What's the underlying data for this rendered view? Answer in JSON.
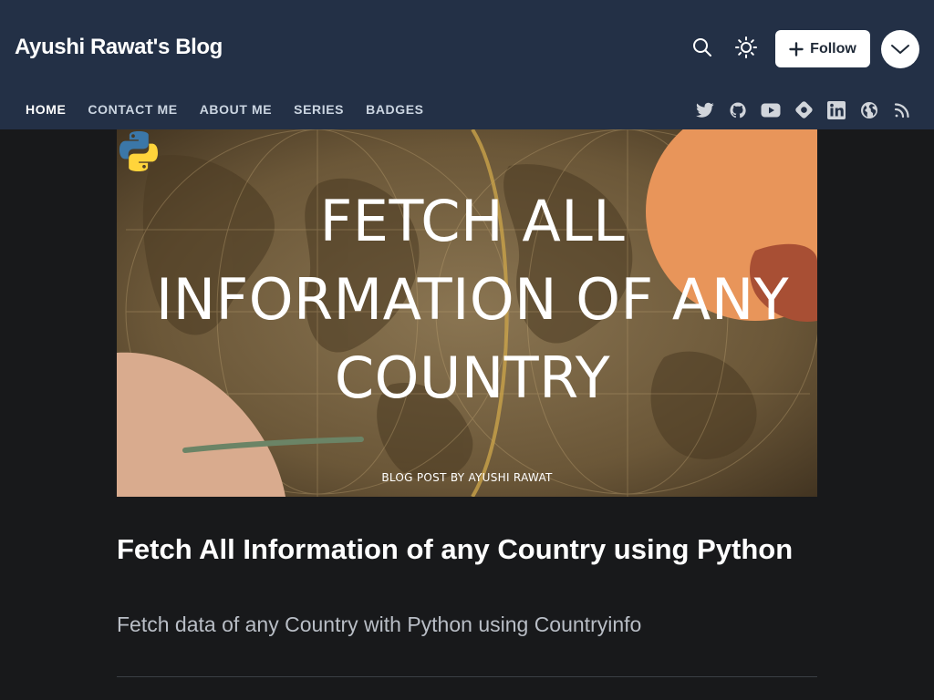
{
  "header": {
    "blog_title": "Ayushi Rawat's Blog",
    "follow_label": "Follow"
  },
  "nav": {
    "items": [
      {
        "label": "HOME",
        "active": true
      },
      {
        "label": "CONTACT ME"
      },
      {
        "label": "ABOUT ME"
      },
      {
        "label": "SERIES"
      },
      {
        "label": "BADGES"
      }
    ]
  },
  "social_icons": [
    "twitter-icon",
    "github-icon",
    "youtube-icon",
    "hashnode-icon",
    "linkedin-icon",
    "website-icon",
    "rss-icon"
  ],
  "cover": {
    "title": "FETCH ALL INFORMATION OF ANY COUNTRY",
    "byline": "BLOG POST BY AYUSHI RAWAT"
  },
  "post": {
    "title": "Fetch All Information of any Country using Python",
    "subtitle": "Fetch data of any Country with Python using Countryinfo"
  },
  "colors": {
    "header_bg": "#233046",
    "page_bg": "#18191b",
    "accent_orange": "#e8955a",
    "accent_rust": "#a84f34",
    "accent_peach": "#d9ab8e"
  }
}
